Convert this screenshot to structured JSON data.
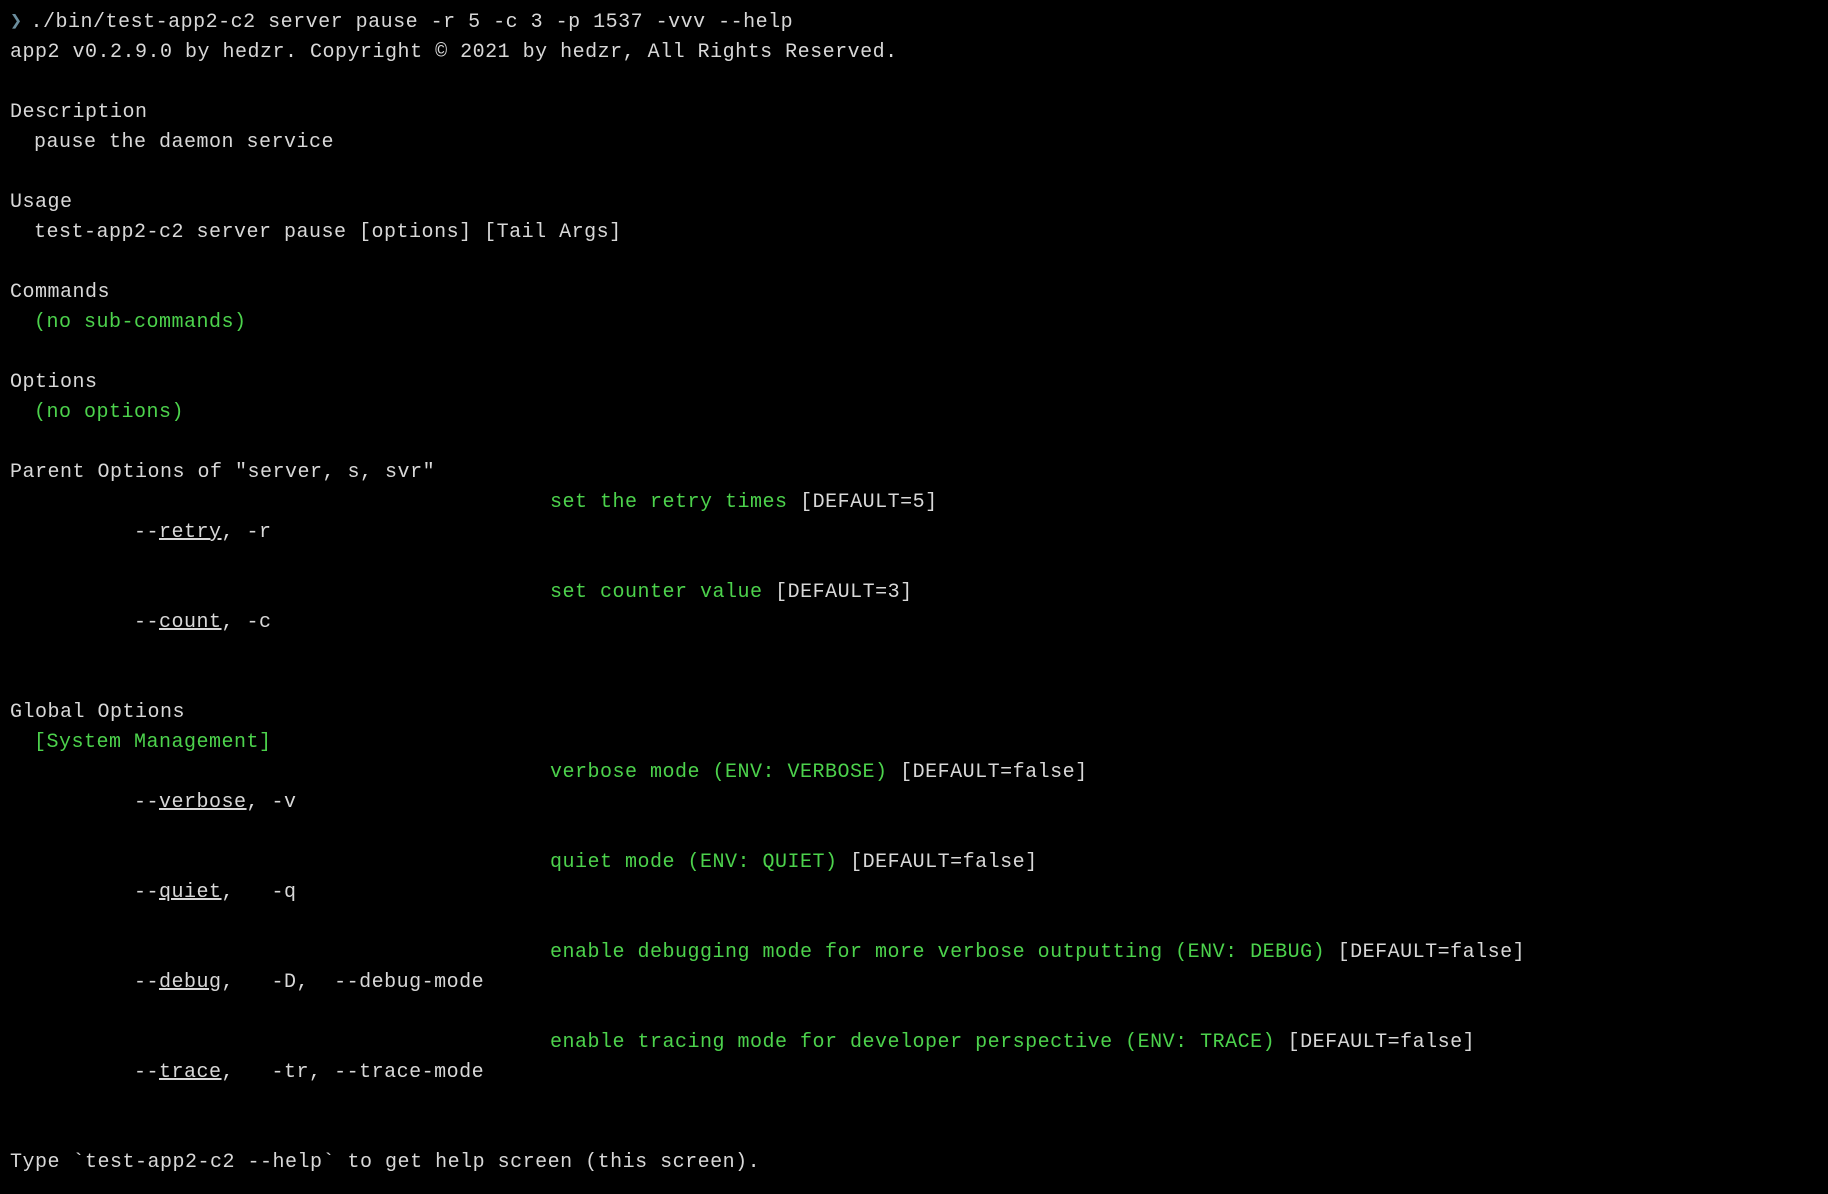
{
  "prompt": {
    "symbol": "❯",
    "command": "./bin/test-app2-c2 server pause -r 5 -c 3 -p 1537 -vvv --help"
  },
  "header": "app2 v0.2.9.0 by hedzr. Copyright © 2021 by hedzr, All Rights Reserved.",
  "description": {
    "title": "Description",
    "text": "pause the daemon service"
  },
  "usage": {
    "title": "Usage",
    "text": "test-app2-c2 server pause [options] [Tail Args]"
  },
  "commands": {
    "title": "Commands",
    "text": "(no sub-commands)"
  },
  "options": {
    "title": "Options",
    "text": "(no options)"
  },
  "parent_options": {
    "title": "Parent Options of \"server, s, svr\"",
    "items": [
      {
        "prefix": "--",
        "name": "retry",
        "suffix": ", -r",
        "desc": "set the retry times",
        "default": "[DEFAULT=5]"
      },
      {
        "prefix": "--",
        "name": "count",
        "suffix": ", -c",
        "desc": "set counter value",
        "default": "[DEFAULT=3]"
      }
    ]
  },
  "global_options": {
    "title": "Global Options",
    "group": "[System Management]",
    "items": [
      {
        "prefix": "--",
        "name": "verbose",
        "suffix": ", -v",
        "desc": "verbose mode (ENV: VERBOSE)",
        "default": "[DEFAULT=false]"
      },
      {
        "prefix": "--",
        "name": "quiet",
        "suffix": ",   -q",
        "desc": "quiet mode (ENV: QUIET)",
        "default": "[DEFAULT=false]"
      },
      {
        "prefix": "--",
        "name": "debug",
        "suffix": ",   -D,  --debug-mode",
        "desc": "enable debugging mode for more verbose outputting (ENV: DEBUG)",
        "default": "[DEFAULT=false]"
      },
      {
        "prefix": "--",
        "name": "trace",
        "suffix": ",   -tr, --trace-mode",
        "desc": "enable tracing mode for developer perspective (ENV: TRACE)",
        "default": "[DEFAULT=false]"
      }
    ]
  },
  "footer": "Type `test-app2-c2 --help` to get help screen (this screen)."
}
